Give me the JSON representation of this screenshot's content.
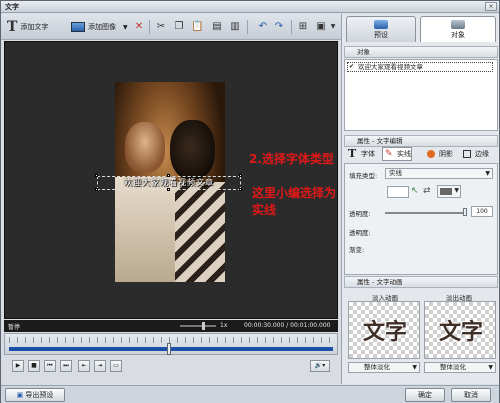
{
  "window": {
    "title": "文字",
    "close_icon": "×"
  },
  "toolbar": {
    "add_text_label": "添加文字",
    "add_image_label": "添加图像"
  },
  "preview": {
    "subtitle_text": "欢迎大家观看视频文章",
    "annotation_line1": "2.选择字体类型",
    "annotation_line2": "这里小编选择为实线"
  },
  "playbar": {
    "status": "暂停",
    "speed": "1x",
    "time": "00:00:30.000 / 00:01:00.000"
  },
  "bottom": {
    "export_preset_label": "导出预设",
    "ok_label": "确定",
    "cancel_label": "取消"
  },
  "right_panel": {
    "tabs": [
      {
        "label": "预设"
      },
      {
        "label": "对象"
      }
    ],
    "objects_header": "对象",
    "object_item": "欢迎大家观看视频文章",
    "props_header": "属性 - 文字编辑",
    "subtabs": [
      {
        "label": "字体"
      },
      {
        "label": "实线"
      },
      {
        "label": "阴影"
      },
      {
        "label": "边缘"
      }
    ],
    "fill_type_label": "填充类型:",
    "fill_type_value": "实线",
    "opacity_label": "透明度:",
    "opacity_value": "100",
    "field_label_2": "透明度:",
    "field_label_3": "渐变:",
    "anim_header": "属性 - 文字动画",
    "enter_anim_label": "淡入动画",
    "exit_anim_label": "淡出动画",
    "tile_text": "文字",
    "enter_anim_select": "整体淡化",
    "exit_anim_select": "整体淡化"
  }
}
